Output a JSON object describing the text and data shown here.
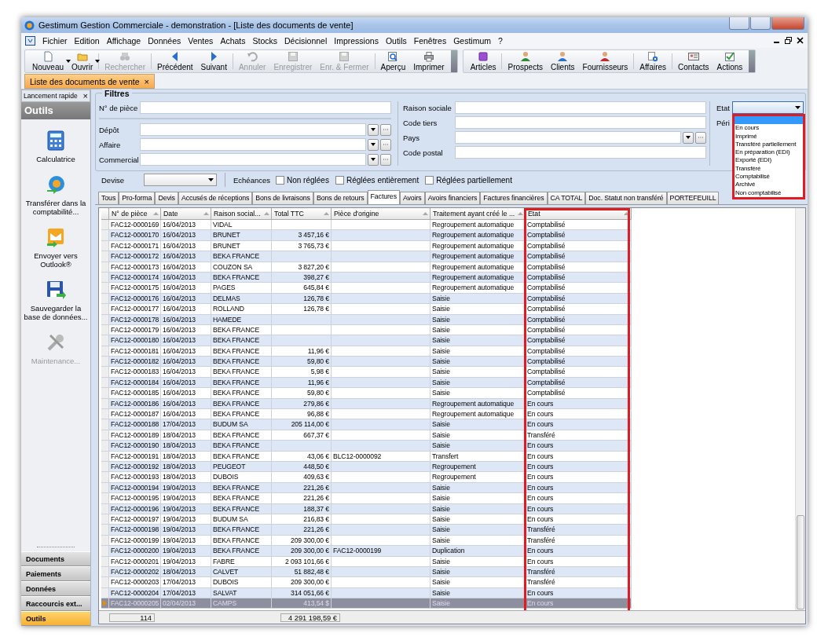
{
  "window": {
    "title": "Gestimum Gestion Commerciale - demonstration - [Liste des documents de vente]"
  },
  "menu": [
    "Fichier",
    "Edition",
    "Affichage",
    "Données",
    "Ventes",
    "Achats",
    "Stocks",
    "Décisionnel",
    "Impressions",
    "Outils",
    "Fenêtres",
    "Gestimum",
    "?"
  ],
  "toolbar": [
    {
      "label": "Nouveau",
      "disabled": false,
      "dropdown": true
    },
    {
      "label": "Ouvrir",
      "disabled": false,
      "dropdown": true
    },
    {
      "label": "Rechercher",
      "disabled": true,
      "dropdown": false
    },
    {
      "label": "Précédent",
      "disabled": false,
      "dropdown": false
    },
    {
      "label": "Suivant",
      "disabled": false,
      "dropdown": false
    },
    {
      "label": "Annuler",
      "disabled": true,
      "dropdown": false
    },
    {
      "label": "Enregistrer",
      "disabled": true,
      "dropdown": false
    },
    {
      "label": "Enr. & Fermer",
      "disabled": true,
      "dropdown": false
    },
    {
      "label": "Aperçu",
      "disabled": false,
      "dropdown": false
    },
    {
      "label": "Imprimer",
      "disabled": false,
      "dropdown": false
    }
  ],
  "toolbar2": [
    {
      "label": "Articles"
    },
    {
      "label": "Prospects"
    },
    {
      "label": "Clients"
    },
    {
      "label": "Fournisseurs"
    },
    {
      "label": "Affaires"
    },
    {
      "label": "Contacts"
    },
    {
      "label": "Actions"
    }
  ],
  "document_tabs": [
    {
      "label": "Liste des documents de vente",
      "close": "×",
      "selected": true
    }
  ],
  "sidebar": {
    "header": "Lancement rapide",
    "close": "×",
    "title": "Outils",
    "items": [
      {
        "label": "Calculatrice",
        "disabled": false
      },
      {
        "label": "Transférer dans la comptabilité...",
        "disabled": false
      },
      {
        "label": "Envoyer vers Outlook®",
        "disabled": false
      },
      {
        "label": "Sauvegarder la base de données...",
        "disabled": false
      },
      {
        "label": "Maintenance...",
        "disabled": true
      }
    ],
    "nav": [
      {
        "label": "Documents",
        "selected": false
      },
      {
        "label": "Paiements",
        "selected": false
      },
      {
        "label": "Données",
        "selected": false
      },
      {
        "label": "Raccourcis ext...",
        "selected": false
      },
      {
        "label": "Outils",
        "selected": true
      }
    ]
  },
  "filters": {
    "title": "Filtres",
    "left_top": {
      "label": "N° de pièce"
    },
    "left": [
      {
        "label": "Dépôt"
      },
      {
        "label": "Affaire"
      },
      {
        "label": "Commercial"
      }
    ],
    "middle": [
      {
        "label": "Raison sociale",
        "kind": "text"
      },
      {
        "label": "Code tiers",
        "kind": "text"
      },
      {
        "label": "Pays",
        "kind": "lookup"
      },
      {
        "label": "Code postal",
        "kind": "text"
      }
    ],
    "etat": {
      "label": "Etat",
      "blank_highlighted": true,
      "options": [
        "En cours",
        "Imprimé",
        "Transféré partiellement",
        "En préparation (EDI)",
        "Exporté (EDI)",
        "Transféré",
        "Comptabilisé",
        "Archivé",
        "Non comptabilisé"
      ]
    },
    "periode_label": "Péri",
    "devise": {
      "label": "Devise"
    },
    "echeances": {
      "label": "Echéances",
      "options": [
        {
          "label": "Non réglées",
          "checked": false
        },
        {
          "label": "Réglées entièrement",
          "checked": false
        },
        {
          "label": "Réglées partiellement",
          "checked": false
        }
      ]
    }
  },
  "tabs": [
    {
      "label": "Tous",
      "selected": false
    },
    {
      "label": "Pro-forma",
      "selected": false
    },
    {
      "label": "Devis",
      "selected": false
    },
    {
      "label": "Accusés de réceptions",
      "selected": false
    },
    {
      "label": "Bons de livraisons",
      "selected": false
    },
    {
      "label": "Bons de retours",
      "selected": false
    },
    {
      "label": "Factures",
      "selected": true
    },
    {
      "label": "Avoirs",
      "selected": false
    },
    {
      "label": "Avoirs financiers",
      "selected": false
    },
    {
      "label": "Factures financières",
      "selected": false
    },
    {
      "label": "CA TOTAL",
      "selected": false
    },
    {
      "label": "Doc. Statut non transféré",
      "selected": false
    },
    {
      "label": "PORTEFEUILL",
      "selected": false
    }
  ],
  "table": {
    "columns": [
      "N° de pièce",
      "Date",
      "Raison social...",
      "Total TTC",
      "Pièce d'origine",
      "Traitement ayant créé le ...",
      "Etat"
    ],
    "rows": [
      {
        "numero": "FAC12-0000169",
        "date": "16/04/2013",
        "raison_sociale": "VIDAL",
        "traitement": "Regroupement automatique",
        "etat": "Comptabilisé",
        "selected": false
      },
      {
        "numero": "FAC12-0000170",
        "date": "16/04/2013",
        "raison_sociale": "BRUNET",
        "total_ttc": "3 457,16 €",
        "traitement": "Regroupement automatique",
        "etat": "Comptabilisé",
        "selected": false
      },
      {
        "numero": "FAC12-0000171",
        "date": "16/04/2013",
        "raison_sociale": "BRUNET",
        "total_ttc": "3 765,73 €",
        "traitement": "Regroupement automatique",
        "etat": "Comptabilisé",
        "selected": false
      },
      {
        "numero": "FAC12-0000172",
        "date": "16/04/2013",
        "raison_sociale": "BEKA FRANCE",
        "traitement": "Regroupement automatique",
        "etat": "Comptabilisé",
        "selected": false
      },
      {
        "numero": "FAC12-0000173",
        "date": "16/04/2013",
        "raison_sociale": "COUZON SA",
        "total_ttc": "3 827,20 €",
        "traitement": "Regroupement automatique",
        "etat": "Comptabilisé",
        "selected": false
      },
      {
        "numero": "FAC12-0000174",
        "date": "16/04/2013",
        "raison_sociale": "BEKA FRANCE",
        "total_ttc": "398,27 €",
        "traitement": "Regroupement automatique",
        "etat": "Comptabilisé",
        "selected": false
      },
      {
        "numero": "FAC12-0000175",
        "date": "16/04/2013",
        "raison_sociale": "PAGES",
        "total_ttc": "645,84 €",
        "traitement": "Regroupement automatique",
        "etat": "Comptabilisé",
        "selected": false
      },
      {
        "numero": "FAC12-0000176",
        "date": "16/04/2013",
        "raison_sociale": "DELMAS",
        "total_ttc": "126,78 €",
        "traitement": "Saisie",
        "etat": "Comptabilisé",
        "selected": false
      },
      {
        "numero": "FAC12-0000177",
        "date": "16/04/2013",
        "raison_sociale": "ROLLAND",
        "total_ttc": "126,78 €",
        "traitement": "Saisie",
        "etat": "Comptabilisé",
        "selected": false
      },
      {
        "numero": "FAC12-0000178",
        "date": "16/04/2013",
        "raison_sociale": "HAMEDE",
        "traitement": "Saisie",
        "etat": "Comptabilisé",
        "selected": false
      },
      {
        "numero": "FAC12-0000179",
        "date": "16/04/2013",
        "raison_sociale": "BEKA FRANCE",
        "traitement": "Saisie",
        "etat": "Comptabilisé",
        "selected": false
      },
      {
        "numero": "FAC12-0000180",
        "date": "16/04/2013",
        "raison_sociale": "BEKA FRANCE",
        "traitement": "Saisie",
        "etat": "Comptabilisé",
        "selected": false
      },
      {
        "numero": "FAC12-0000181",
        "date": "16/04/2013",
        "raison_sociale": "BEKA FRANCE",
        "total_ttc": "11,96 €",
        "traitement": "Saisie",
        "etat": "Comptabilisé",
        "selected": false
      },
      {
        "numero": "FAC12-0000182",
        "date": "16/04/2013",
        "raison_sociale": "BEKA FRANCE",
        "total_ttc": "59,80 €",
        "traitement": "Saisie",
        "etat": "Comptabilisé",
        "selected": false
      },
      {
        "numero": "FAC12-0000183",
        "date": "16/04/2013",
        "raison_sociale": "BEKA FRANCE",
        "total_ttc": "5,98 €",
        "traitement": "Saisie",
        "etat": "Comptabilisé",
        "selected": false
      },
      {
        "numero": "FAC12-0000184",
        "date": "16/04/2013",
        "raison_sociale": "BEKA FRANCE",
        "total_ttc": "11,96 €",
        "traitement": "Saisie",
        "etat": "Comptabilisé",
        "selected": false
      },
      {
        "numero": "FAC12-0000185",
        "date": "16/04/2013",
        "raison_sociale": "BEKA FRANCE",
        "total_ttc": "59,80 €",
        "traitement": "Saisie",
        "etat": "Comptabilisé",
        "selected": false
      },
      {
        "numero": "FAC12-0000186",
        "date": "16/04/2013",
        "raison_sociale": "BEKA FRANCE",
        "total_ttc": "279,86 €",
        "traitement": "Regroupement automatique",
        "etat": "En cours",
        "selected": false
      },
      {
        "numero": "FAC12-0000187",
        "date": "16/04/2013",
        "raison_sociale": "BEKA FRANCE",
        "total_ttc": "96,88 €",
        "traitement": "Regroupement automatique",
        "etat": "En cours",
        "selected": false
      },
      {
        "numero": "FAC12-0000188",
        "date": "17/04/2013",
        "raison_sociale": "BUDUM SA",
        "total_ttc": "205 114,00 €",
        "traitement": "Saisie",
        "etat": "En cours",
        "selected": false
      },
      {
        "numero": "FAC12-0000189",
        "date": "18/04/2013",
        "raison_sociale": "BEKA FRANCE",
        "total_ttc": "667,37 €",
        "traitement": "Saisie",
        "etat": "Transféré",
        "selected": false
      },
      {
        "numero": "FAC12-0000190",
        "date": "18/04/2013",
        "raison_sociale": "BEKA FRANCE",
        "traitement": "Saisie",
        "etat": "En cours",
        "selected": false
      },
      {
        "numero": "FAC12-0000191",
        "date": "18/04/2013",
        "raison_sociale": "BEKA FRANCE",
        "total_ttc": "43,06 €",
        "piece_origine": "BLC12-0000092",
        "traitement": "Transfert",
        "etat": "En cours",
        "selected": false
      },
      {
        "numero": "FAC12-0000192",
        "date": "18/04/2013",
        "raison_sociale": "PEUGEOT",
        "total_ttc": "448,50 €",
        "traitement": "Regroupement",
        "etat": "En cours",
        "selected": false
      },
      {
        "numero": "FAC12-0000193",
        "date": "18/04/2013",
        "raison_sociale": "DUBOIS",
        "total_ttc": "409,63 €",
        "traitement": "Regroupement",
        "etat": "En cours",
        "selected": false
      },
      {
        "numero": "FAC12-0000194",
        "date": "19/04/2013",
        "raison_sociale": "BEKA FRANCE",
        "total_ttc": "221,26 €",
        "traitement": "Saisie",
        "etat": "En cours",
        "selected": false
      },
      {
        "numero": "FAC12-0000195",
        "date": "19/04/2013",
        "raison_sociale": "BEKA FRANCE",
        "total_ttc": "221,26 €",
        "traitement": "Saisie",
        "etat": "En cours",
        "selected": false
      },
      {
        "numero": "FAC12-0000196",
        "date": "19/04/2013",
        "raison_sociale": "BEKA FRANCE",
        "total_ttc": "188,37 €",
        "traitement": "Saisie",
        "etat": "En cours",
        "selected": false
      },
      {
        "numero": "FAC12-0000197",
        "date": "19/04/2013",
        "raison_sociale": "BUDUM SA",
        "total_ttc": "216,83 €",
        "traitement": "Saisie",
        "etat": "En cours",
        "selected": false
      },
      {
        "numero": "FAC12-0000198",
        "date": "19/04/2013",
        "raison_sociale": "BEKA FRANCE",
        "total_ttc": "221,26 €",
        "traitement": "Saisie",
        "etat": "Transféré",
        "selected": false
      },
      {
        "numero": "FAC12-0000199",
        "date": "19/04/2013",
        "raison_sociale": "BEKA FRANCE",
        "total_ttc": "209 300,00 €",
        "traitement": "Saisie",
        "etat": "Transféré",
        "selected": false
      },
      {
        "numero": "FAC12-0000200",
        "date": "19/04/2013",
        "raison_sociale": "BEKA FRANCE",
        "total_ttc": "209 300,00 €",
        "piece_origine": "FAC12-0000199",
        "traitement": "Duplication",
        "etat": "En cours",
        "selected": false
      },
      {
        "numero": "FAC12-0000201",
        "date": "19/04/2013",
        "raison_sociale": "FABRE",
        "total_ttc": "2 093 101,66 €",
        "traitement": "Saisie",
        "etat": "En cours",
        "selected": false
      },
      {
        "numero": "FAC12-0000202",
        "date": "18/04/2013",
        "raison_sociale": "CALVET",
        "total_ttc": "51 882,48 €",
        "traitement": "Saisie",
        "etat": "Transféré",
        "selected": false
      },
      {
        "numero": "FAC12-0000203",
        "date": "17/04/2013",
        "raison_sociale": "DUBOIS",
        "total_ttc": "209 300,00 €",
        "traitement": "Saisie",
        "etat": "Transféré",
        "selected": false
      },
      {
        "numero": "FAC12-0000204",
        "date": "17/04/2013",
        "raison_sociale": "SALVAT",
        "total_ttc": "314 051,66 €",
        "traitement": "Saisie",
        "etat": "En cours",
        "selected": false
      },
      {
        "numero": "FAC12-0000205",
        "date": "02/04/2013",
        "raison_sociale": "CAMPS",
        "total_ttc": "413,54 $",
        "traitement": "Saisie",
        "etat": "En cours",
        "selected": true
      }
    ],
    "footer": {
      "count": "114",
      "total": "4 291 198,59 €"
    }
  }
}
